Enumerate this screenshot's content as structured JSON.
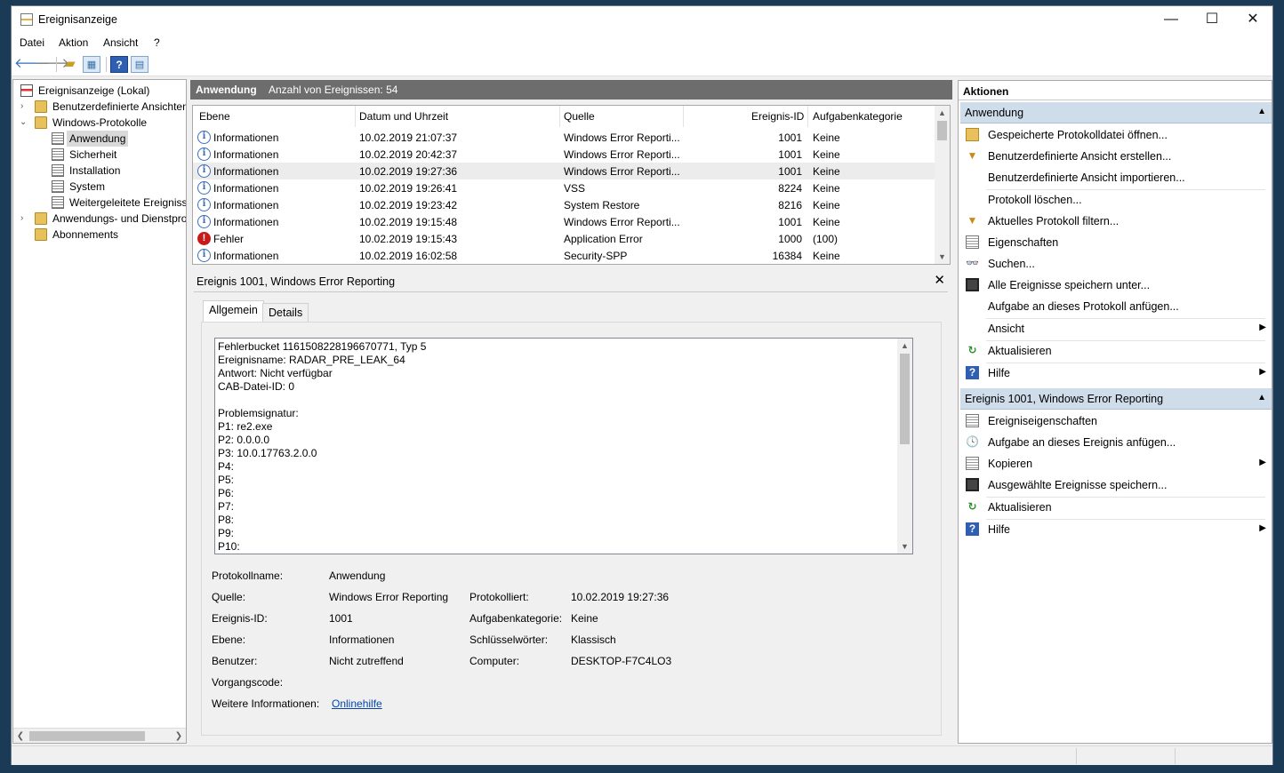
{
  "window": {
    "title": "Ereignisanzeige",
    "minimize": "—",
    "maximize": "☐",
    "close": "✕"
  },
  "menu": {
    "items": [
      "Datei",
      "Aktion",
      "Ansicht",
      "?"
    ]
  },
  "tree": {
    "root": "Ereignisanzeige (Lokal)",
    "custom_views": "Benutzerdefinierte Ansichten",
    "windows_logs": "Windows-Protokolle",
    "logs": [
      "Anwendung",
      "Sicherheit",
      "Installation",
      "System",
      "Weitergeleitete Ereignisse"
    ],
    "app_logs": "Anwendungs- und Dienstprotokolle",
    "subscriptions": "Abonnements"
  },
  "list": {
    "title": "Anwendung",
    "count_text": "Anzahl von Ereignissen: 54",
    "columns": [
      "Ebene",
      "Datum und Uhrzeit",
      "Quelle",
      "Ereignis-ID",
      "Aufgabenkategorie"
    ],
    "rows": [
      {
        "level": "Informationen",
        "date": "10.02.2019 21:07:37",
        "source": "Windows Error Reporti...",
        "id": "1001",
        "category": "Keine",
        "type": "info"
      },
      {
        "level": "Informationen",
        "date": "10.02.2019 20:42:37",
        "source": "Windows Error Reporti...",
        "id": "1001",
        "category": "Keine",
        "type": "info"
      },
      {
        "level": "Informationen",
        "date": "10.02.2019 19:27:36",
        "source": "Windows Error Reporti...",
        "id": "1001",
        "category": "Keine",
        "type": "info"
      },
      {
        "level": "Informationen",
        "date": "10.02.2019 19:26:41",
        "source": "VSS",
        "id": "8224",
        "category": "Keine",
        "type": "info"
      },
      {
        "level": "Informationen",
        "date": "10.02.2019 19:23:42",
        "source": "System Restore",
        "id": "8216",
        "category": "Keine",
        "type": "info"
      },
      {
        "level": "Informationen",
        "date": "10.02.2019 19:15:48",
        "source": "Windows Error Reporti...",
        "id": "1001",
        "category": "Keine",
        "type": "info"
      },
      {
        "level": "Fehler",
        "date": "10.02.2019 19:15:43",
        "source": "Application Error",
        "id": "1000",
        "category": "(100)",
        "type": "error"
      },
      {
        "level": "Informationen",
        "date": "10.02.2019 16:02:58",
        "source": "Security-SPP",
        "id": "16384",
        "category": "Keine",
        "type": "info"
      }
    ]
  },
  "detail": {
    "title": "Ereignis 1001, Windows Error Reporting",
    "tabs": [
      "Allgemein",
      "Details"
    ],
    "description_lines": [
      "Fehlerbucket 1161508228196670771, Typ 5",
      "Ereignisname: RADAR_PRE_LEAK_64",
      "Antwort: Nicht verfügbar",
      "CAB-Datei-ID: 0",
      "",
      "Problemsignatur:",
      "P1: re2.exe",
      "P2: 0.0.0.0",
      "P3: 10.0.17763.2.0.0",
      "P4:",
      "P5:",
      "P6:",
      "P7:",
      "P8:",
      "P9:",
      "P10:"
    ],
    "props": {
      "log_name_label": "Protokollname:",
      "log_name": "Anwendung",
      "source_label": "Quelle:",
      "source": "Windows Error Reporting",
      "logged_label": "Protokolliert:",
      "logged": "10.02.2019 19:27:36",
      "event_id_label": "Ereignis-ID:",
      "event_id": "1001",
      "task_label": "Aufgabenkategorie:",
      "task": "Keine",
      "level_label": "Ebene:",
      "level": "Informationen",
      "keywords_label": "Schlüsselwörter:",
      "keywords": "Klassisch",
      "user_label": "Benutzer:",
      "user": "Nicht zutreffend",
      "computer_label": "Computer:",
      "computer": "DESKTOP-F7C4LO3",
      "opcode_label": "Vorgangscode:",
      "more_info_label": "Weitere Informationen:",
      "more_info_link": "Onlinehilfe"
    }
  },
  "actions": {
    "header": "Aktionen",
    "section1": "Anwendung",
    "items1": [
      "Gespeicherte Protokolldatei öffnen...",
      "Benutzerdefinierte Ansicht erstellen...",
      "Benutzerdefinierte Ansicht importieren...",
      "Protokoll löschen...",
      "Aktuelles Protokoll filtern...",
      "Eigenschaften",
      "Suchen...",
      "Alle Ereignisse speichern unter...",
      "Aufgabe an dieses Protokoll anfügen...",
      "Ansicht",
      "Aktualisieren",
      "Hilfe"
    ],
    "section2": "Ereignis 1001, Windows Error Reporting",
    "items2": [
      "Ereigniseigenschaften",
      "Aufgabe an dieses Ereignis anfügen...",
      "Kopieren",
      "Ausgewählte Ereignisse speichern...",
      "Aktualisieren",
      "Hilfe"
    ]
  }
}
